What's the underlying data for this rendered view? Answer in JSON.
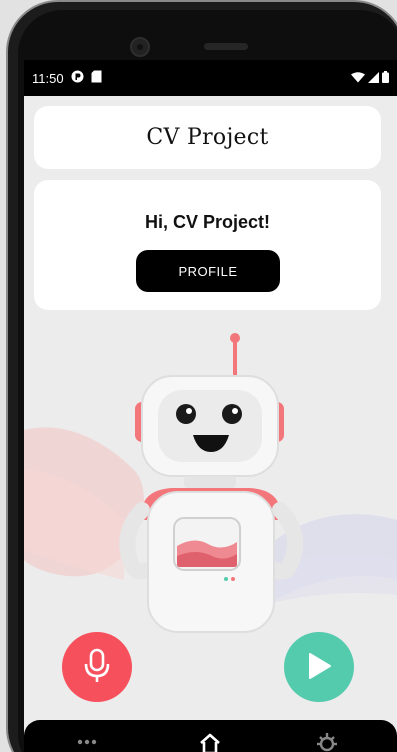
{
  "status_bar": {
    "time": "11:50"
  },
  "header": {
    "title": "CV Project"
  },
  "greeting": {
    "text": "Hi, CV Project!",
    "profile_button_label": "PROFILE"
  },
  "actions": {
    "mic_icon": "microphone-icon",
    "play_icon": "play-icon",
    "mic_color": "#f6505d",
    "play_color": "#55cbae"
  },
  "nav": {
    "items": [
      {
        "icon": "more-dots-icon"
      },
      {
        "icon": "home-icon"
      },
      {
        "icon": "settings-icon"
      }
    ]
  },
  "colors": {
    "background": "#ececec",
    "card": "#ffffff",
    "button": "#000000",
    "robot_accent": "#f2767a"
  }
}
